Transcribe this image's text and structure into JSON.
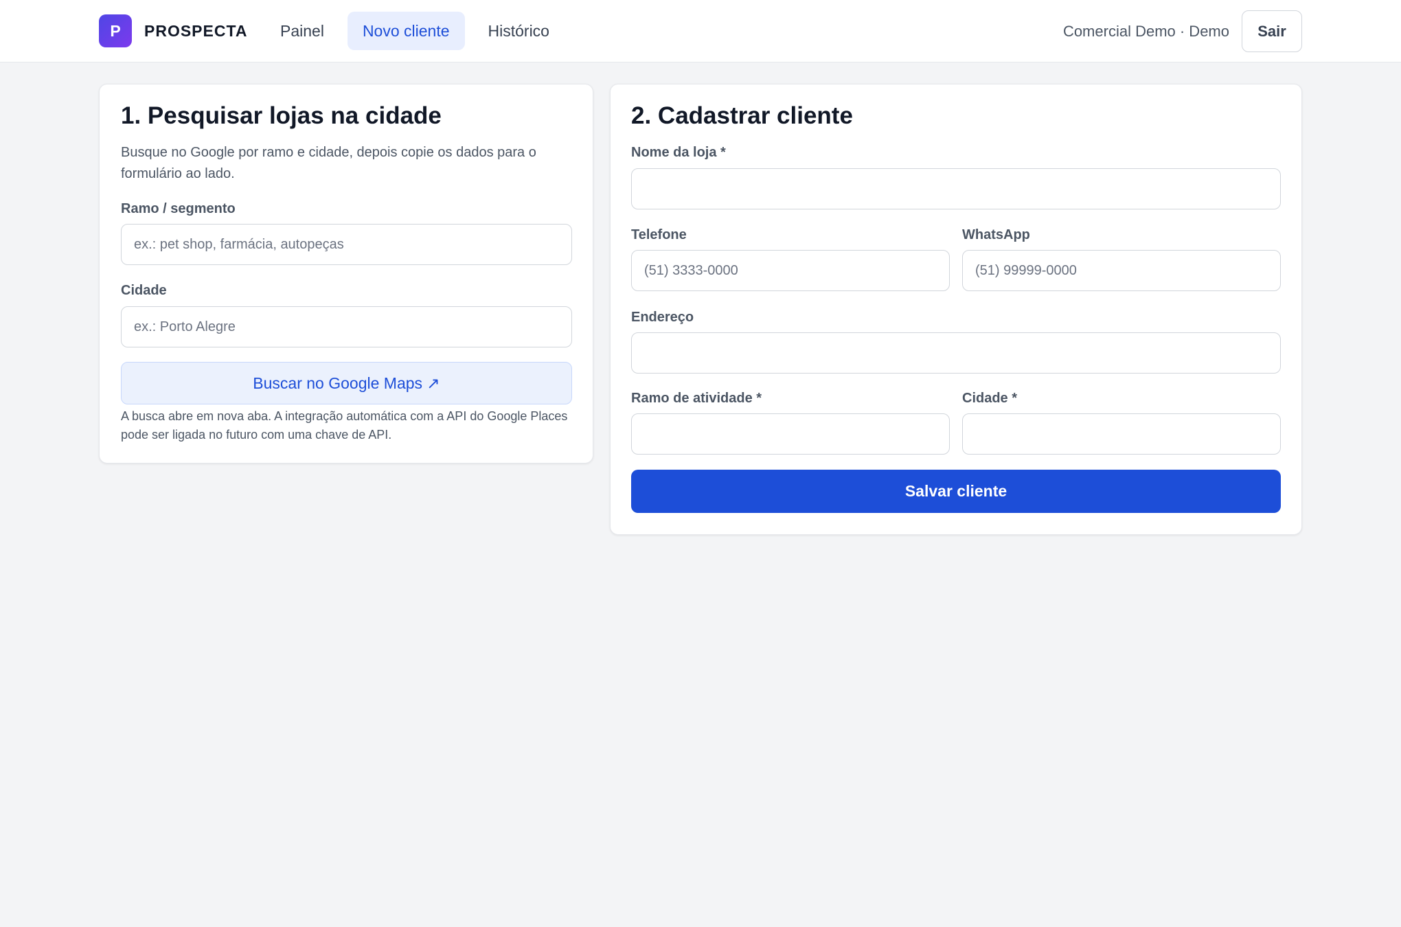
{
  "app": {
    "logo_letter": "P",
    "brand": "PROSPECTA",
    "accent_color": "#1d4ed8",
    "logo_gradient": [
      "#4f46e5",
      "#7c3aed"
    ]
  },
  "nav": {
    "items": [
      {
        "label": "Painel"
      },
      {
        "label": "Novo cliente"
      },
      {
        "label": "Histórico"
      }
    ],
    "active_index": 1
  },
  "user": {
    "label": "Comercial Demo · Demo",
    "logout_label": "Sair"
  },
  "search_panel": {
    "title": "1. Pesquisar lojas na cidade",
    "description": "Busque no Google por ramo e cidade, depois copie os dados para o formulário ao lado.",
    "segment_label": "Ramo / segmento",
    "segment_placeholder": "ex.: pet shop, farmácia, autopeças",
    "city_label": "Cidade",
    "city_placeholder": "ex.: Porto Alegre",
    "maps_button": "Buscar no Google Maps ↗",
    "note": "A busca abre em nova aba. A integração automática com a API do Google Places pode ser ligada no futuro com uma chave de API."
  },
  "client_form": {
    "title": "2. Cadastrar cliente",
    "store_name_label": "Nome da loja *",
    "store_name_value": "",
    "phone_label": "Telefone",
    "phone_placeholder": "(51) 3333-0000",
    "whatsapp_label": "WhatsApp",
    "whatsapp_placeholder": "(51) 99999-0000",
    "address_label": "Endereço",
    "address_value": "",
    "activity_label": "Ramo de atividade *",
    "activity_value": "",
    "city_label": "Cidade *",
    "city_value": "",
    "save_button": "Salvar cliente"
  }
}
